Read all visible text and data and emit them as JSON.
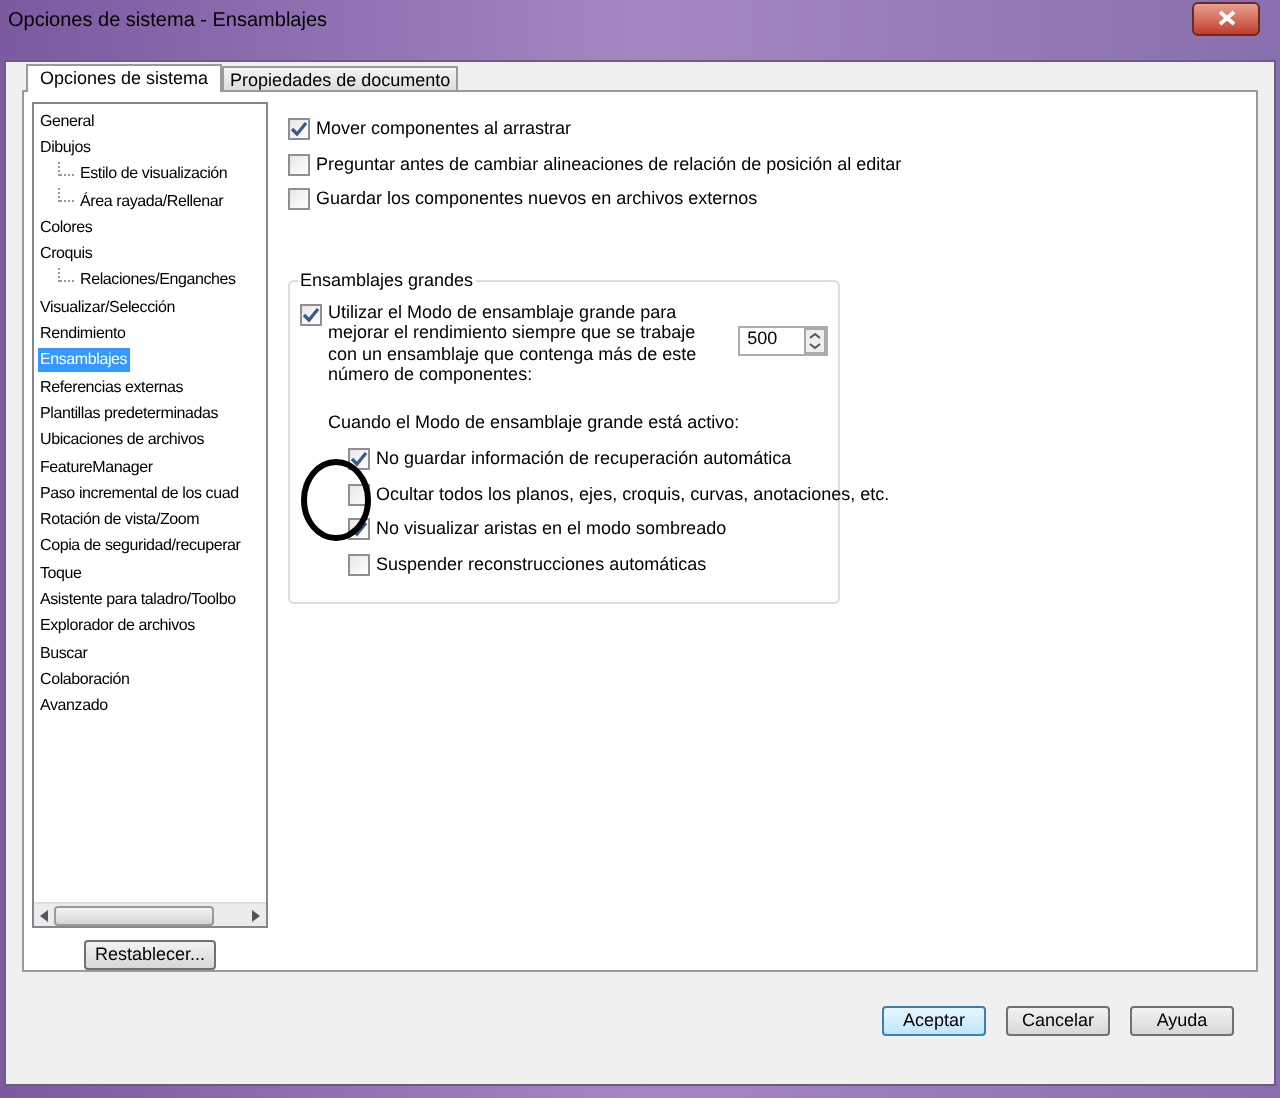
{
  "window": {
    "title": "Opciones de sistema - Ensamblajes"
  },
  "tabs": [
    {
      "label": "Opciones de sistema",
      "selected": true
    },
    {
      "label": "Propiedades de documento",
      "selected": false
    }
  ],
  "tree": [
    {
      "label": "General",
      "selected": false
    },
    {
      "label": "Dibujos",
      "selected": false,
      "children": [
        {
          "label": "Estilo de visualización",
          "selected": false
        },
        {
          "label": "Área rayada/Rellenar",
          "selected": false
        }
      ]
    },
    {
      "label": "Colores",
      "selected": false
    },
    {
      "label": "Croquis",
      "selected": false,
      "children": [
        {
          "label": "Relaciones/Enganches",
          "selected": false
        }
      ]
    },
    {
      "label": "Visualizar/Selección",
      "selected": false
    },
    {
      "label": "Rendimiento",
      "selected": false
    },
    {
      "label": "Ensamblajes",
      "selected": true
    },
    {
      "label": "Referencias externas",
      "selected": false
    },
    {
      "label": "Plantillas predeterminadas",
      "selected": false
    },
    {
      "label": "Ubicaciones de archivos",
      "selected": false
    },
    {
      "label": "FeatureManager",
      "selected": false
    },
    {
      "label": "Paso incremental de los cuad",
      "selected": false
    },
    {
      "label": "Rotación de vista/Zoom",
      "selected": false
    },
    {
      "label": "Copia de seguridad/recuperar",
      "selected": false
    },
    {
      "label": "Toque",
      "selected": false
    },
    {
      "label": "Asistente para taladro/Toolbo",
      "selected": false
    },
    {
      "label": "Explorador de archivos",
      "selected": false
    },
    {
      "label": "Buscar",
      "selected": false
    },
    {
      "label": "Colaboración",
      "selected": false
    },
    {
      "label": "Avanzado",
      "selected": false
    }
  ],
  "reset_button": "Restablecer...",
  "options": [
    {
      "label": "Mover componentes al arrastrar",
      "checked": true
    },
    {
      "label": "Preguntar antes de cambiar alineaciones de relación de posición al editar",
      "checked": false
    },
    {
      "label": "Guardar los componentes nuevos en archivos externos",
      "checked": false
    }
  ],
  "large_assemblies": {
    "title": "Ensamblajes grandes",
    "use_large_mode": {
      "label": "Utilizar el Modo de ensamblaje grande para mejorar el rendimiento siempre que se trabaje con un ensamblaje que contenga más de este número de componentes:",
      "checked": true
    },
    "threshold": "500",
    "subtitle": "Cuando el Modo de ensamblaje grande está activo:",
    "options": [
      {
        "label": "No guardar información de recuperación automática",
        "checked": true
      },
      {
        "label": "Ocultar todos los planos, ejes, croquis, curvas, anotaciones, etc.",
        "checked": false
      },
      {
        "label": "No visualizar aristas en el modo sombreado",
        "checked": true
      },
      {
        "label": "Suspender reconstrucciones automáticas",
        "checked": false
      }
    ]
  },
  "buttons": [
    {
      "label": "Aceptar",
      "default": true
    },
    {
      "label": "Cancelar",
      "default": false
    },
    {
      "label": "Ayuda",
      "default": false
    }
  ]
}
